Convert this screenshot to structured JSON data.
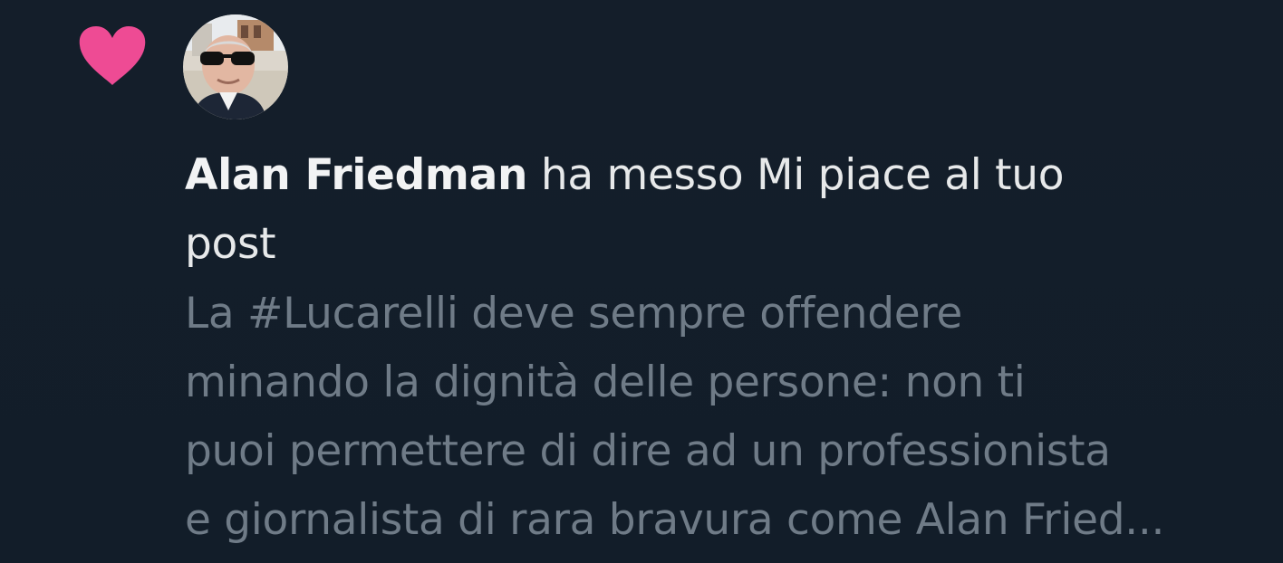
{
  "notification": {
    "actor_name": "Alan Friedman",
    "action_line1": " ha messo Mi piace al tuo",
    "action_line2": "post",
    "post_preview_lines": [
      "La #Lucarelli deve sempre offendere",
      "minando la dignità delle persone: non ti",
      "puoi permettere di dire ad un professionista",
      "e giornalista di rara bravura come Alan Fried..."
    ]
  },
  "icons": {
    "like": "heart-icon",
    "avatar": "avatar"
  },
  "colors": {
    "background": "#15202b",
    "heart": "#f91880",
    "primary_text": "#e7e9ea",
    "secondary_text": "#71767b"
  }
}
